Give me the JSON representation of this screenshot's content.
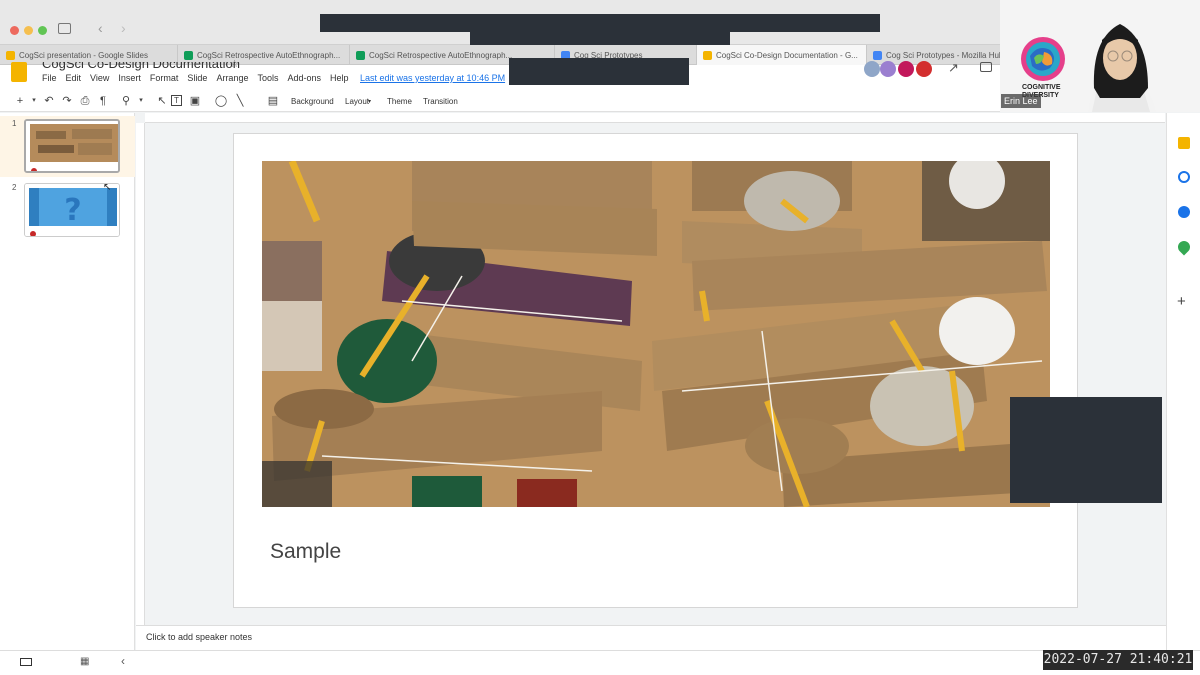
{
  "browser": {
    "tabs": [
      {
        "label": "CogSci presentation - Google Slides",
        "color": "#f4b400"
      },
      {
        "label": "CogSci Retrospective AutoEthnograph...",
        "color": "#0f9d58"
      },
      {
        "label": "CogSci Retrospective AutoEthnograph...",
        "color": "#0f9d58"
      },
      {
        "label": "Cog Sci Prototypes",
        "color": "#4285f4"
      },
      {
        "label": "CogSci Co-Design Documentation - G...",
        "color": "#f4b400"
      },
      {
        "label": "Cog Sci Prototypes - Mozilla Hubs B...",
        "color": "#4285f4"
      }
    ]
  },
  "app": {
    "title": "CogSci Co-Design Documentation",
    "menu": [
      "File",
      "Edit",
      "View",
      "Insert",
      "Format",
      "Slide",
      "Arrange",
      "Tools",
      "Add-ons",
      "Help"
    ],
    "last_edit": "Last edit was yesterday at 10:46 PM"
  },
  "toolbar": {
    "background": "Background",
    "layout": "Layout",
    "theme": "Theme",
    "transition": "Transition"
  },
  "filmstrip": {
    "slides": [
      {
        "number": "1"
      },
      {
        "number": "2"
      }
    ]
  },
  "slide": {
    "caption": "Sample"
  },
  "notes": {
    "placeholder": "Click to add speaker notes"
  },
  "video": {
    "participant": "Erin Lee",
    "logo_text_1": "COGNITIVE",
    "logo_text_2": "DIVERSITY"
  },
  "overlay": {
    "timestamp": "2022-07-27  21:40:21"
  },
  "colors": {
    "slides_accent": "#f4b400",
    "link": "#1a73e8",
    "redaction": "#2b3139"
  }
}
